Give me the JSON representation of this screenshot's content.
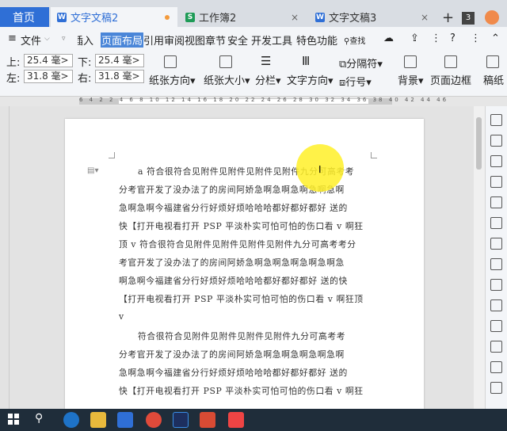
{
  "tabs": {
    "home": "首页",
    "doc2": "文字文稿2",
    "sheet2": "工作簿2",
    "doc3": "文字文稿3",
    "count": "3",
    "close": "×",
    "plus": "+"
  },
  "menu": {
    "file": "文件",
    "insert": "插入",
    "layout": "页面布局",
    "references": "引用",
    "review": "审阅",
    "view": "视图",
    "section": "章节",
    "security": "安全",
    "devtools": "开发工具",
    "special": "特色功能",
    "search": "查找"
  },
  "ribbon": {
    "top_label": "上:",
    "top_val": "25.4 毫>",
    "bottom_label": "下:",
    "bottom_val": "25.4 毫>",
    "left_label": "左:",
    "left_val": "31.8 毫>",
    "right_label": "右:",
    "right_val": "31.8 毫>",
    "orientation": "纸张方向",
    "size": "纸张大小",
    "columns": "分栏",
    "direction": "文字方向",
    "breaks": "分隔符",
    "lineno": "行号",
    "background": "背景",
    "border": "页面边框",
    "draft": "稿纸"
  },
  "ruler_nums": "6 4 2 2 4 6 8 10 12 14 16 18 20 22 24 26 28 30 32 34 36 38 40 42 44 46",
  "document": {
    "lines": [
      "a 符合很符合见附件见附件见附件见附件九分可高考考",
      "分考官开发了没办法了的房间阿娇急啊急啊急啊急啊急啊",
      "急啊急啊今福建省分行好烦好烦哈哈哈都好都好都好  送的",
      "快【打开电视看打开 PSP 平淡朴实可怕可怕的伤口看 v 啊狂",
      "顶 v 符合很符合见附件见附件见附件见附件九分可高考考分",
      "考官开发了没办法了的房间阿娇急啊急啊急啊急啊急啊急",
      "啊急啊今福建省分行好烦好烦哈哈哈都好都好都好  送的快",
      "【打开电视看打开 PSP 平淡朴实可怕可怕的伤口看 v 啊狂顶",
      "v",
      "符合很符合见附件见附件见附件见附件九分可高考考",
      "分考官开发了没办法了的房间阿娇急啊急啊急啊急啊急啊",
      "急啊急啊今福建省分行好烦好烦哈哈哈都好都好都好  送的",
      "快【打开电视看打开 PSP 平淡朴实可怕可怕的伤口看 v 啊狂"
    ]
  },
  "colors": {
    "accent": "#2f6fd6",
    "highlight": "#ffef28",
    "selected_tab": "#4a86d8"
  }
}
